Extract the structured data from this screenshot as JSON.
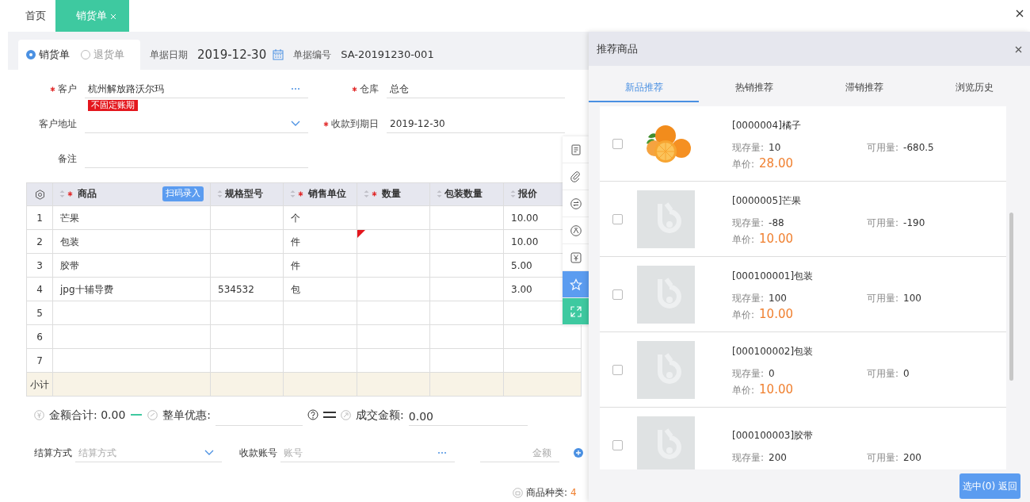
{
  "tabs": [
    {
      "label": "首页",
      "selected": false,
      "closable": false
    },
    {
      "label": "销货单",
      "selected": true,
      "closable": true
    }
  ],
  "order_type": [
    {
      "label": "销货单",
      "selected": true
    },
    {
      "label": "退货单",
      "selected": false
    }
  ],
  "doc_date": {
    "label": "单据日期",
    "value": "2019-12-30"
  },
  "doc_no": {
    "label": "单据编号",
    "value": "SA-20191230-001"
  },
  "fields": [
    {
      "label": "客户",
      "required": true,
      "kind": "lookup",
      "value": "杭州解放路沃尔玛",
      "tag": "不固定账期"
    },
    {
      "label": "仓库",
      "required": true,
      "kind": "text",
      "value": "总仓"
    },
    {
      "label": "客户地址",
      "required": false,
      "kind": "select"
    },
    {
      "label": "收款到期日",
      "required": true,
      "kind": "text",
      "value": "2019-12-30"
    },
    {
      "label": "备注",
      "required": false,
      "kind": "text"
    }
  ],
  "table": {
    "scan_button": "扫码录入",
    "columns": [
      {
        "label": "商品",
        "required": true
      },
      {
        "label": "规格型号",
        "required": false
      },
      {
        "label": "销售单位",
        "required": true
      },
      {
        "label": "数量",
        "required": true
      },
      {
        "label": "包装数量",
        "required": false
      },
      {
        "label": "报价",
        "required": false
      }
    ],
    "rows": [
      {
        "no": "1",
        "cells": [
          "芒果",
          "",
          "个",
          "",
          "",
          "10.00"
        ],
        "flagged": false
      },
      {
        "no": "2",
        "cells": [
          "包装",
          "",
          "件",
          "",
          "",
          "10.00"
        ],
        "flagged": true
      },
      {
        "no": "3",
        "cells": [
          "胶带",
          "",
          "件",
          "",
          "",
          "5.00"
        ],
        "flagged": false
      },
      {
        "no": "4",
        "cells": [
          "jpg十辅导费",
          "534532",
          "包",
          "",
          "",
          "3.00"
        ],
        "flagged": false
      },
      {
        "no": "5",
        "cells": [
          "",
          "",
          "",
          "",
          "",
          ""
        ],
        "flagged": false
      },
      {
        "no": "6",
        "cells": [
          "",
          "",
          "",
          "",
          "",
          ""
        ],
        "flagged": false
      },
      {
        "no": "7",
        "cells": [
          "",
          "",
          "",
          "",
          "",
          ""
        ],
        "flagged": false
      }
    ],
    "subtotal_label": "小计"
  },
  "totals": {
    "sum_label": "金额合计:",
    "sum": "0.00",
    "discount_label": "整单优惠:",
    "final_label": "成交金额:",
    "final": "0.00"
  },
  "payment": {
    "method_label": "结算方式",
    "method_placeholder": "结算方式",
    "account_label": "收款账号",
    "account_placeholder": "账号",
    "amount_placeholder": "金额"
  },
  "status": {
    "label": "商品种类:",
    "count": "4"
  },
  "side_tools": [
    {
      "kind": "plain"
    },
    {
      "kind": "plain"
    },
    {
      "kind": "plain"
    },
    {
      "kind": "plain"
    },
    {
      "kind": "plain"
    },
    {
      "kind": "accent",
      "color": "#5b9cf0"
    },
    {
      "kind": "accent",
      "color": "#3ec9a0"
    }
  ],
  "panel": {
    "title": "推荐商品",
    "tabs": [
      {
        "label": "新品推荐",
        "selected": true
      },
      {
        "label": "热销推荐",
        "selected": false
      },
      {
        "label": "滞销推荐",
        "selected": false
      },
      {
        "label": "浏览历史",
        "selected": false
      }
    ],
    "products": [
      {
        "name": "[0000004]橘子",
        "checked": false,
        "kind": "orange",
        "stock_label": "现存量:",
        "stock": "10",
        "avail_label": "可用量:",
        "avail": "-680.5",
        "price_label": "单价:",
        "price": "28.00"
      },
      {
        "name": "[0000005]芒果",
        "checked": false,
        "kind": "placeholder",
        "stock_label": "现存量:",
        "stock": "-88",
        "avail_label": "可用量:",
        "avail": "-190",
        "price_label": "单价:",
        "price": "10.00"
      },
      {
        "name": "[000100001]包装",
        "checked": false,
        "kind": "placeholder",
        "stock_label": "现存量:",
        "stock": "100",
        "avail_label": "可用量:",
        "avail": "100",
        "price_label": "单价:",
        "price": "10.00"
      },
      {
        "name": "[000100002]包装",
        "checked": false,
        "kind": "placeholder",
        "stock_label": "现存量:",
        "stock": "0",
        "avail_label": "可用量:",
        "avail": "0",
        "price_label": "单价:",
        "price": "10.00"
      },
      {
        "name": "[000100003]胶带",
        "checked": false,
        "kind": "placeholder",
        "stock_label": "现存量:",
        "stock": "200",
        "avail_label": "可用量:",
        "avail": "200"
      }
    ],
    "confirm_button": "选中(0) 返回"
  }
}
